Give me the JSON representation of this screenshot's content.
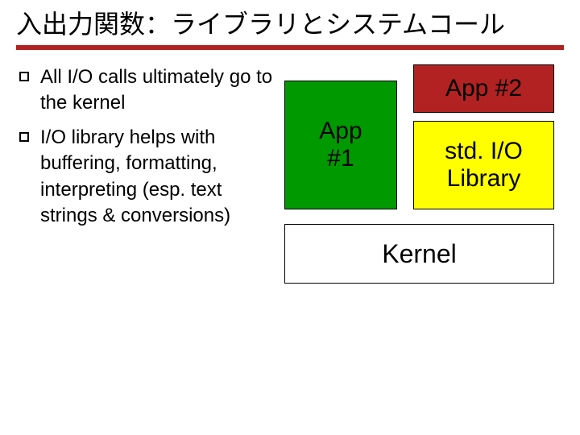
{
  "title": "入出力関数：ライブラリとシステムコール",
  "bullets": [
    "All I/O calls ultimately go to the kernel",
    "I/O library helps with buffering, formatting, interpreting (esp. text strings & conversions)"
  ],
  "diagram": {
    "app1": "App\n#1",
    "app2": "App #2",
    "stdlib": "std. I/O Library",
    "kernel": "Kernel"
  }
}
